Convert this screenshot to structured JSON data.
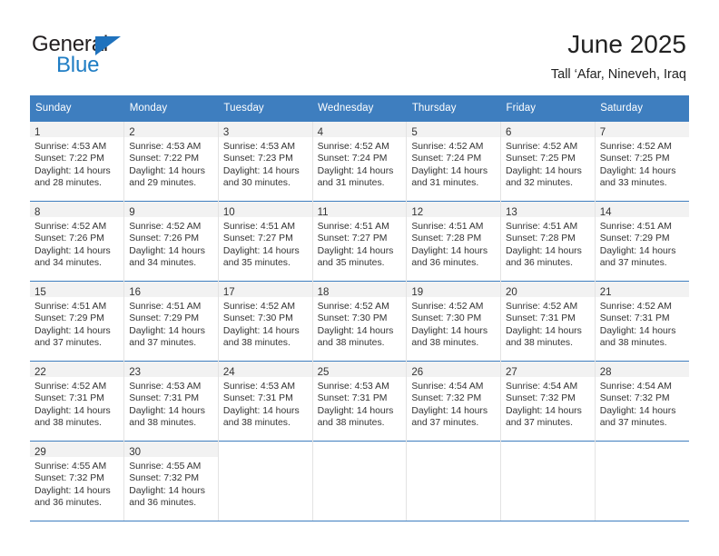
{
  "brand": {
    "name_part1": "General",
    "name_part2": "Blue",
    "triangle_color": "#1f72bd",
    "blue_text_color": "#1f7dc4"
  },
  "header": {
    "title": "June 2025",
    "location": "Tall ‘Afar, Nineveh, Iraq"
  },
  "theme": {
    "header_blue": "#3e7ebf",
    "daynum_band": "#f2f2f2",
    "grid_line": "#e3e3e3"
  },
  "weekdays": [
    "Sunday",
    "Monday",
    "Tuesday",
    "Wednesday",
    "Thursday",
    "Friday",
    "Saturday"
  ],
  "weeks": [
    [
      {
        "day": "1",
        "sunrise": "Sunrise: 4:53 AM",
        "sunset": "Sunset: 7:22 PM",
        "daylight1": "Daylight: 14 hours",
        "daylight2": "and 28 minutes."
      },
      {
        "day": "2",
        "sunrise": "Sunrise: 4:53 AM",
        "sunset": "Sunset: 7:22 PM",
        "daylight1": "Daylight: 14 hours",
        "daylight2": "and 29 minutes."
      },
      {
        "day": "3",
        "sunrise": "Sunrise: 4:53 AM",
        "sunset": "Sunset: 7:23 PM",
        "daylight1": "Daylight: 14 hours",
        "daylight2": "and 30 minutes."
      },
      {
        "day": "4",
        "sunrise": "Sunrise: 4:52 AM",
        "sunset": "Sunset: 7:24 PM",
        "daylight1": "Daylight: 14 hours",
        "daylight2": "and 31 minutes."
      },
      {
        "day": "5",
        "sunrise": "Sunrise: 4:52 AM",
        "sunset": "Sunset: 7:24 PM",
        "daylight1": "Daylight: 14 hours",
        "daylight2": "and 31 minutes."
      },
      {
        "day": "6",
        "sunrise": "Sunrise: 4:52 AM",
        "sunset": "Sunset: 7:25 PM",
        "daylight1": "Daylight: 14 hours",
        "daylight2": "and 32 minutes."
      },
      {
        "day": "7",
        "sunrise": "Sunrise: 4:52 AM",
        "sunset": "Sunset: 7:25 PM",
        "daylight1": "Daylight: 14 hours",
        "daylight2": "and 33 minutes."
      }
    ],
    [
      {
        "day": "8",
        "sunrise": "Sunrise: 4:52 AM",
        "sunset": "Sunset: 7:26 PM",
        "daylight1": "Daylight: 14 hours",
        "daylight2": "and 34 minutes."
      },
      {
        "day": "9",
        "sunrise": "Sunrise: 4:52 AM",
        "sunset": "Sunset: 7:26 PM",
        "daylight1": "Daylight: 14 hours",
        "daylight2": "and 34 minutes."
      },
      {
        "day": "10",
        "sunrise": "Sunrise: 4:51 AM",
        "sunset": "Sunset: 7:27 PM",
        "daylight1": "Daylight: 14 hours",
        "daylight2": "and 35 minutes."
      },
      {
        "day": "11",
        "sunrise": "Sunrise: 4:51 AM",
        "sunset": "Sunset: 7:27 PM",
        "daylight1": "Daylight: 14 hours",
        "daylight2": "and 35 minutes."
      },
      {
        "day": "12",
        "sunrise": "Sunrise: 4:51 AM",
        "sunset": "Sunset: 7:28 PM",
        "daylight1": "Daylight: 14 hours",
        "daylight2": "and 36 minutes."
      },
      {
        "day": "13",
        "sunrise": "Sunrise: 4:51 AM",
        "sunset": "Sunset: 7:28 PM",
        "daylight1": "Daylight: 14 hours",
        "daylight2": "and 36 minutes."
      },
      {
        "day": "14",
        "sunrise": "Sunrise: 4:51 AM",
        "sunset": "Sunset: 7:29 PM",
        "daylight1": "Daylight: 14 hours",
        "daylight2": "and 37 minutes."
      }
    ],
    [
      {
        "day": "15",
        "sunrise": "Sunrise: 4:51 AM",
        "sunset": "Sunset: 7:29 PM",
        "daylight1": "Daylight: 14 hours",
        "daylight2": "and 37 minutes."
      },
      {
        "day": "16",
        "sunrise": "Sunrise: 4:51 AM",
        "sunset": "Sunset: 7:29 PM",
        "daylight1": "Daylight: 14 hours",
        "daylight2": "and 37 minutes."
      },
      {
        "day": "17",
        "sunrise": "Sunrise: 4:52 AM",
        "sunset": "Sunset: 7:30 PM",
        "daylight1": "Daylight: 14 hours",
        "daylight2": "and 38 minutes."
      },
      {
        "day": "18",
        "sunrise": "Sunrise: 4:52 AM",
        "sunset": "Sunset: 7:30 PM",
        "daylight1": "Daylight: 14 hours",
        "daylight2": "and 38 minutes."
      },
      {
        "day": "19",
        "sunrise": "Sunrise: 4:52 AM",
        "sunset": "Sunset: 7:30 PM",
        "daylight1": "Daylight: 14 hours",
        "daylight2": "and 38 minutes."
      },
      {
        "day": "20",
        "sunrise": "Sunrise: 4:52 AM",
        "sunset": "Sunset: 7:31 PM",
        "daylight1": "Daylight: 14 hours",
        "daylight2": "and 38 minutes."
      },
      {
        "day": "21",
        "sunrise": "Sunrise: 4:52 AM",
        "sunset": "Sunset: 7:31 PM",
        "daylight1": "Daylight: 14 hours",
        "daylight2": "and 38 minutes."
      }
    ],
    [
      {
        "day": "22",
        "sunrise": "Sunrise: 4:52 AM",
        "sunset": "Sunset: 7:31 PM",
        "daylight1": "Daylight: 14 hours",
        "daylight2": "and 38 minutes."
      },
      {
        "day": "23",
        "sunrise": "Sunrise: 4:53 AM",
        "sunset": "Sunset: 7:31 PM",
        "daylight1": "Daylight: 14 hours",
        "daylight2": "and 38 minutes."
      },
      {
        "day": "24",
        "sunrise": "Sunrise: 4:53 AM",
        "sunset": "Sunset: 7:31 PM",
        "daylight1": "Daylight: 14 hours",
        "daylight2": "and 38 minutes."
      },
      {
        "day": "25",
        "sunrise": "Sunrise: 4:53 AM",
        "sunset": "Sunset: 7:31 PM",
        "daylight1": "Daylight: 14 hours",
        "daylight2": "and 38 minutes."
      },
      {
        "day": "26",
        "sunrise": "Sunrise: 4:54 AM",
        "sunset": "Sunset: 7:32 PM",
        "daylight1": "Daylight: 14 hours",
        "daylight2": "and 37 minutes."
      },
      {
        "day": "27",
        "sunrise": "Sunrise: 4:54 AM",
        "sunset": "Sunset: 7:32 PM",
        "daylight1": "Daylight: 14 hours",
        "daylight2": "and 37 minutes."
      },
      {
        "day": "28",
        "sunrise": "Sunrise: 4:54 AM",
        "sunset": "Sunset: 7:32 PM",
        "daylight1": "Daylight: 14 hours",
        "daylight2": "and 37 minutes."
      }
    ],
    [
      {
        "day": "29",
        "sunrise": "Sunrise: 4:55 AM",
        "sunset": "Sunset: 7:32 PM",
        "daylight1": "Daylight: 14 hours",
        "daylight2": "and 36 minutes."
      },
      {
        "day": "30",
        "sunrise": "Sunrise: 4:55 AM",
        "sunset": "Sunset: 7:32 PM",
        "daylight1": "Daylight: 14 hours",
        "daylight2": "and 36 minutes."
      },
      {
        "day": "",
        "sunrise": "",
        "sunset": "",
        "daylight1": "",
        "daylight2": ""
      },
      {
        "day": "",
        "sunrise": "",
        "sunset": "",
        "daylight1": "",
        "daylight2": ""
      },
      {
        "day": "",
        "sunrise": "",
        "sunset": "",
        "daylight1": "",
        "daylight2": ""
      },
      {
        "day": "",
        "sunrise": "",
        "sunset": "",
        "daylight1": "",
        "daylight2": ""
      },
      {
        "day": "",
        "sunrise": "",
        "sunset": "",
        "daylight1": "",
        "daylight2": ""
      }
    ]
  ]
}
